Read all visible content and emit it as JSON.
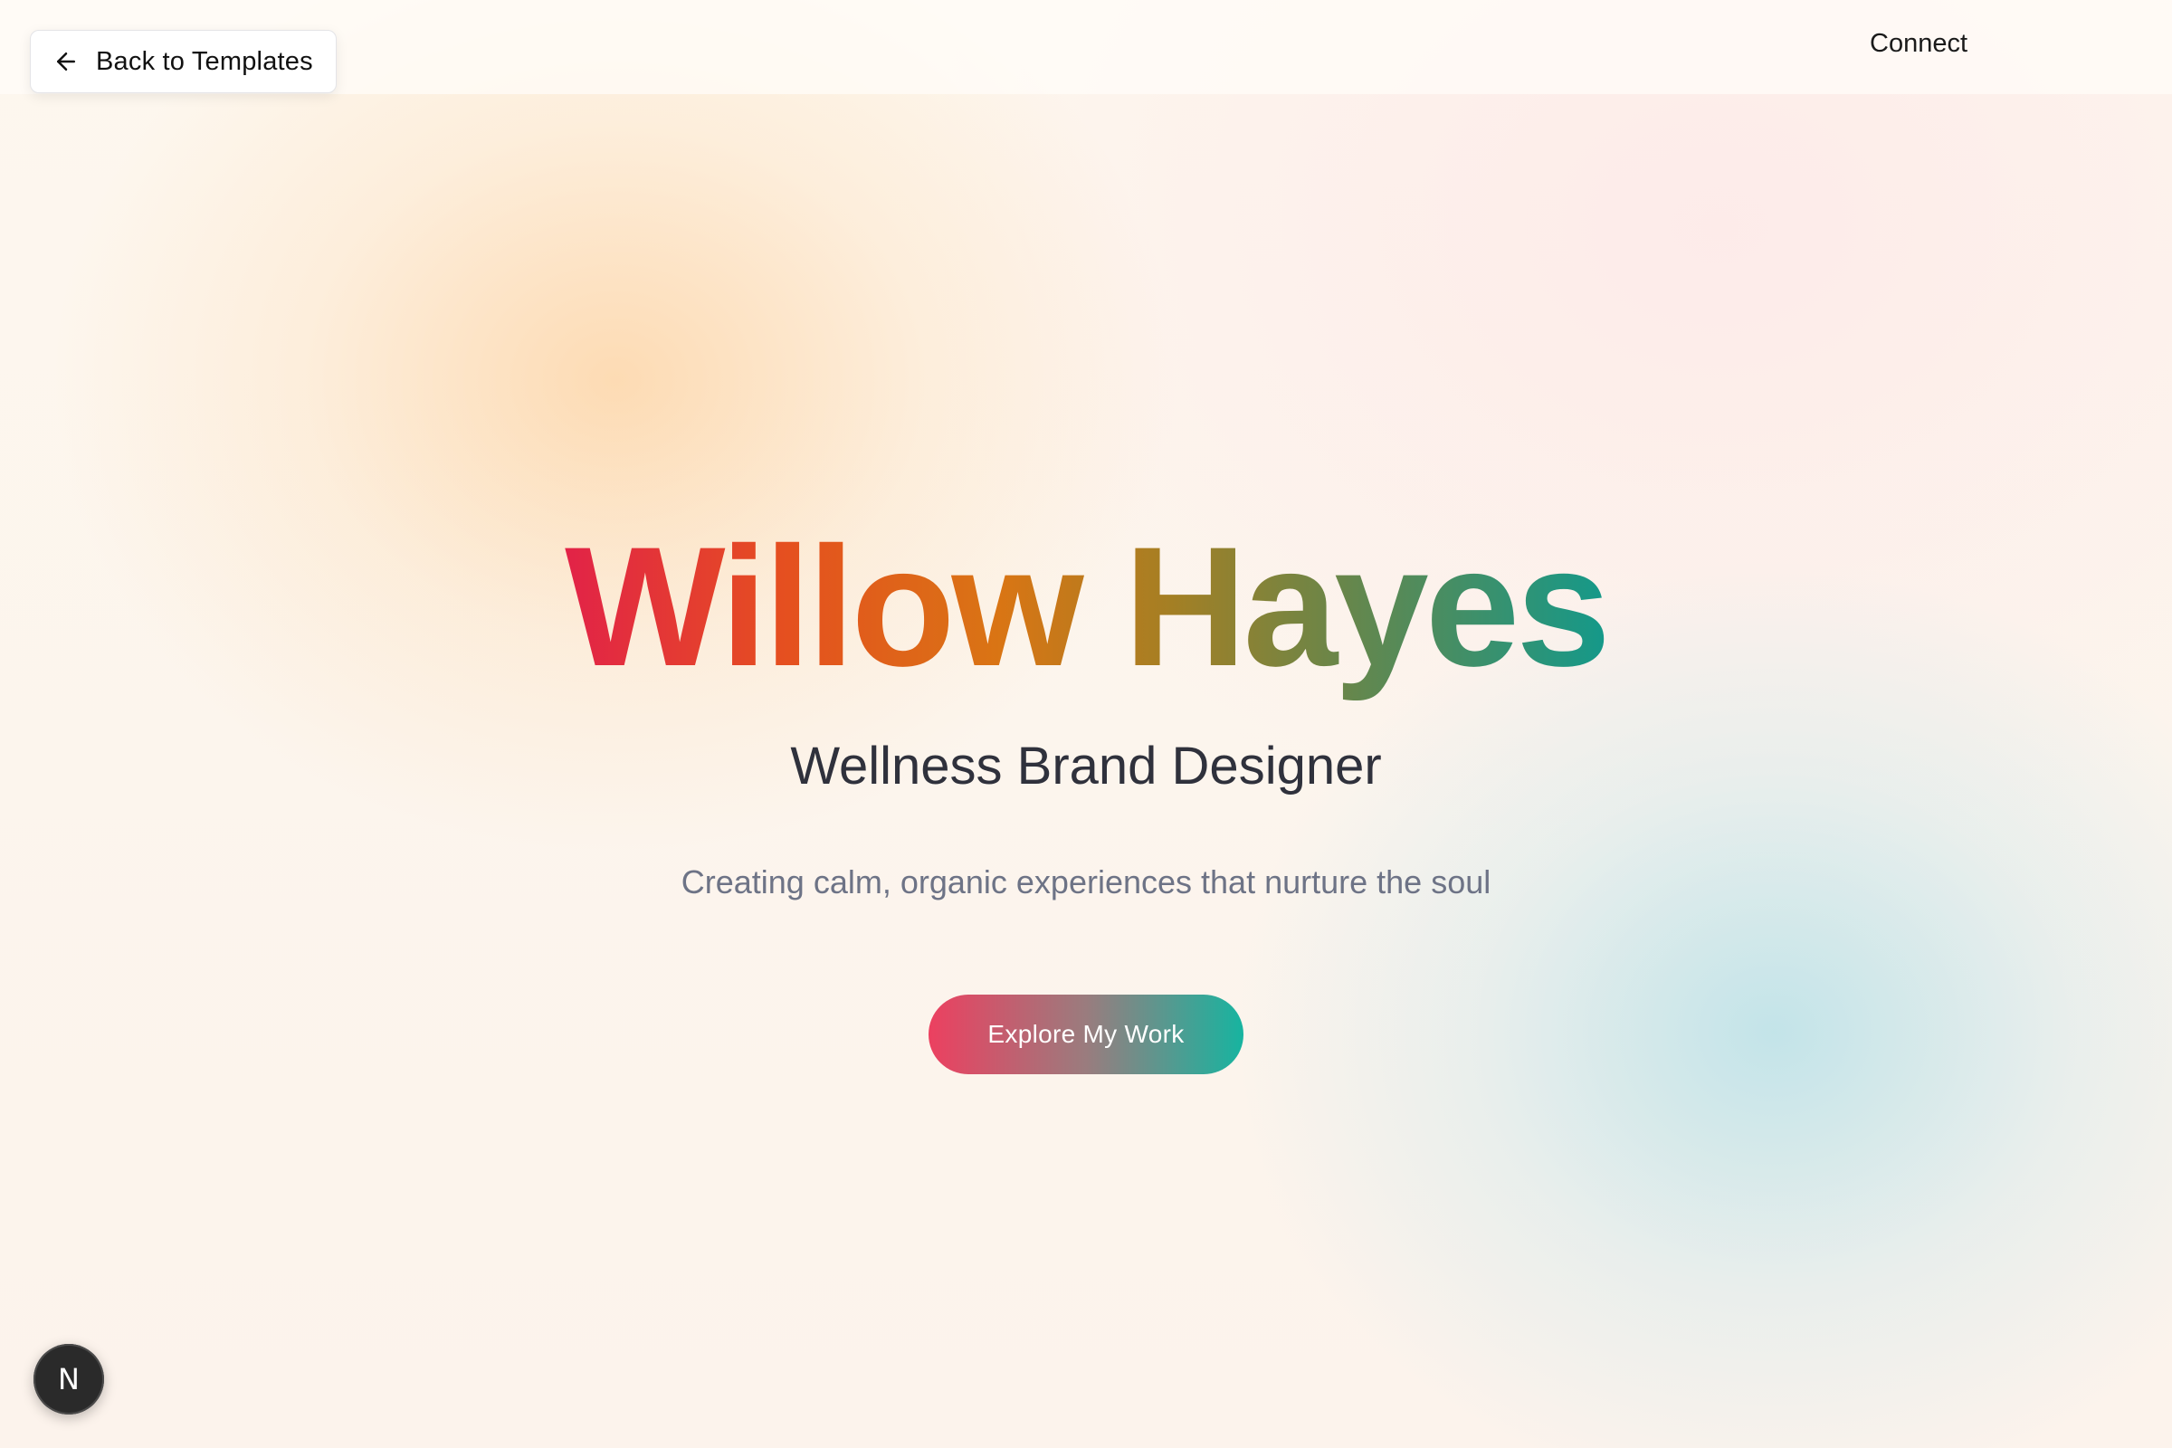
{
  "header": {
    "back_label": "Back to Templates",
    "connect_label": "Connect"
  },
  "hero": {
    "name": "Willow Hayes",
    "subtitle": "Wellness Brand Designer",
    "tagline": "Creating calm, organic experiences that nurture the soul",
    "cta_label": "Explore My Work"
  },
  "badge": {
    "letter": "N"
  },
  "colors": {
    "gradient_start": "#e2204a",
    "gradient_mid": "#d97514",
    "gradient_end": "#109a8d",
    "cta_start": "#ec4060",
    "cta_end": "#17b4a0",
    "text_dark": "#2f313c",
    "text_muted": "#6d7386"
  },
  "icons": {
    "back": "arrow-left-icon",
    "badge": "nextjs-logo"
  }
}
